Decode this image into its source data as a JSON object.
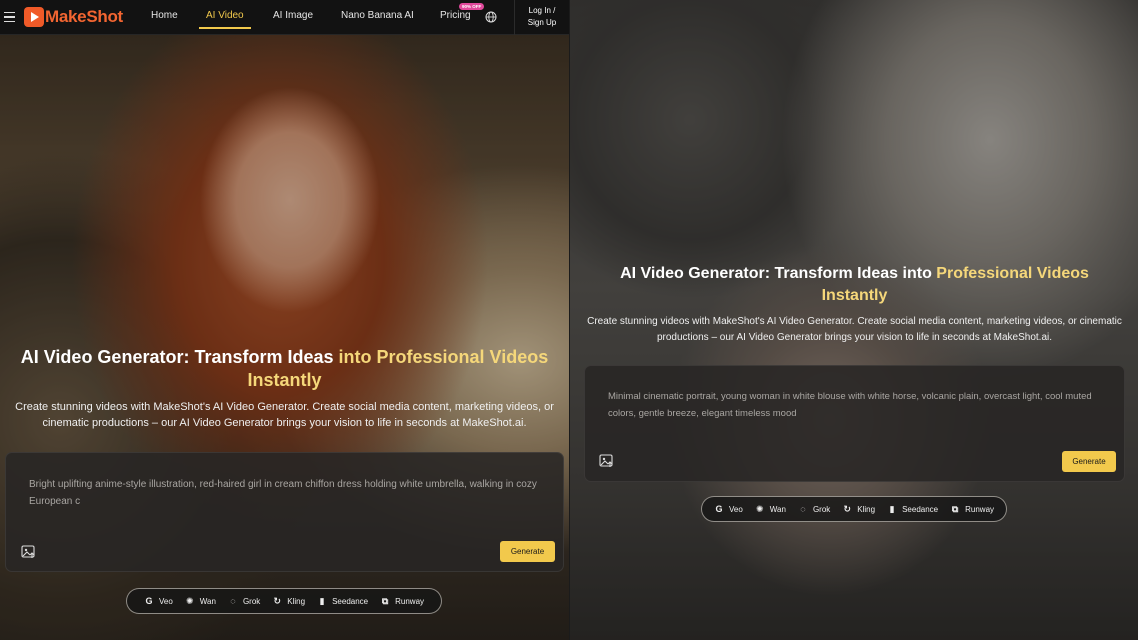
{
  "navbar": {
    "brand": "MakeShot",
    "links": [
      "Home",
      "AI Video",
      "AI Image",
      "Nano Banana AI",
      "Pricing"
    ],
    "active_link": "AI Video",
    "pricing_badge": "90% OFF",
    "login_line1": "Log In /",
    "login_line2": "Sign Up"
  },
  "hero": {
    "title_white_1": "AI Video Generator: Transform Ideas ",
    "title_white_2": "into",
    "title_yellow": " Professional Videos Instantly",
    "subtitle": "Create stunning videos with MakeShot's AI Video Generator. Create social media content, marketing videos, or cinematic productions – our AI Video Generator brings your vision to life in seconds at MakeShot.ai."
  },
  "left_prompt": {
    "text": "Bright uplifting anime-style illustration, red-haired girl in cream chiffon dress holding white umbrella, walking in cozy European c",
    "generate_label": "Generate"
  },
  "right_prompt": {
    "text": "Minimal cinematic portrait, young woman in white blouse with white horse, volcanic plain, overcast light, cool muted colors, gentle breeze, elegant timeless mood",
    "generate_label": "Generate"
  },
  "models": [
    {
      "label": "Veo",
      "icon": "google-g-icon"
    },
    {
      "label": "Wan",
      "icon": "wan-icon"
    },
    {
      "label": "Grok",
      "icon": "grok-icon"
    },
    {
      "label": "Kling",
      "icon": "kling-icon"
    },
    {
      "label": "Seedance",
      "icon": "seedance-icon"
    },
    {
      "label": "Runway",
      "icon": "runway-icon"
    }
  ],
  "colors": {
    "brand": "#f26531",
    "accent": "#f2c94c",
    "badge": "#e0499b"
  }
}
